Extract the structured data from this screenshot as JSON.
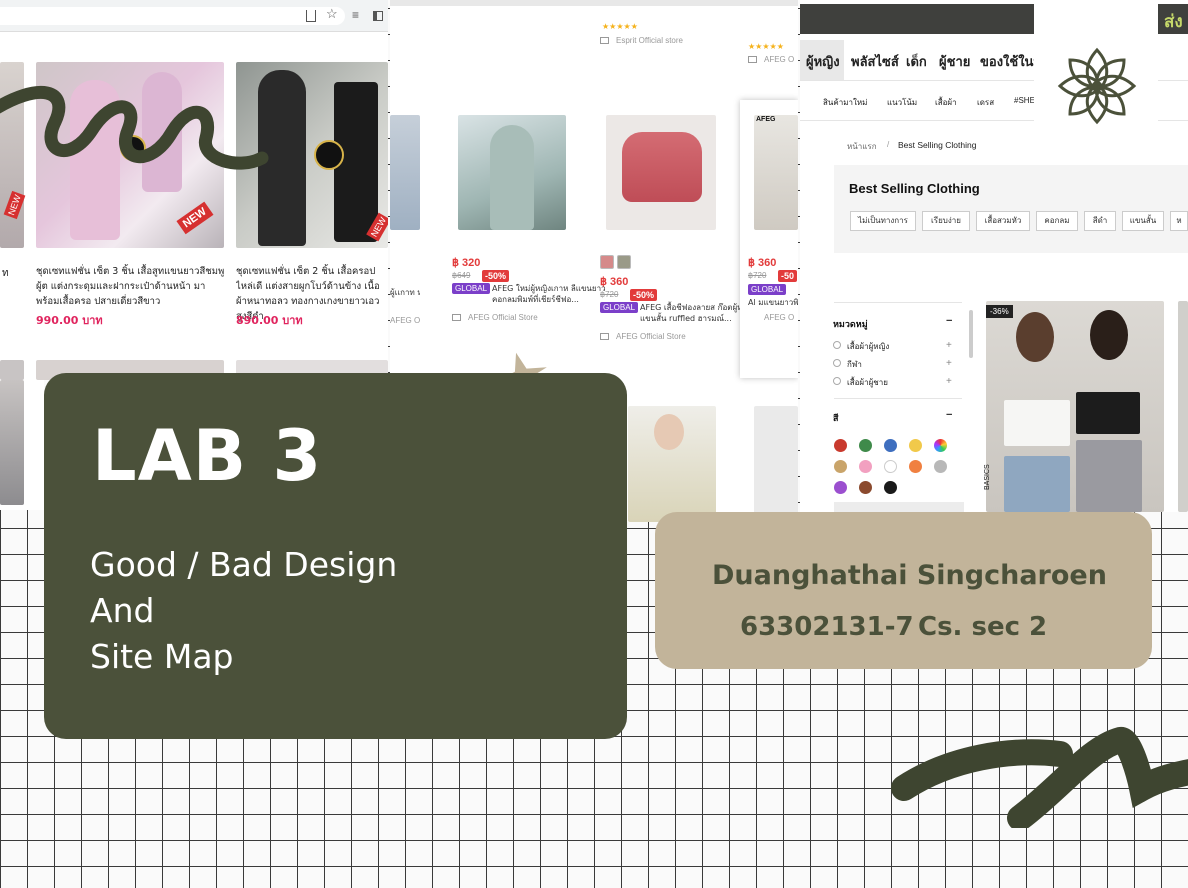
{
  "shot1": {
    "p1_title": "ชุดเซทแฟชั่น เซ็ต 3 ชิ้น เสื้อสูทแขนยาวสีชมพูผู้ต แต่งกระดุมและฝากระเป๋าด้านหน้า มาพร้อมเสื้อครอ ปสายเดี่ยวสีขาว",
    "p1_price": "990.00 บาท",
    "p2_title": "ชุดเซทแฟชั่น เซ็ต 2 ชิ้น เสื้อครอปไหล่เดี แต่งสายผูกโบว์ด้านข้าง เนื้อผ้าหนาทอลว ทองกางเกงขายาวเอวสูงสีดำ",
    "p2_price": "890.00 บาท",
    "left_partial": "ท",
    "new_badge": "NEW"
  },
  "shot2": {
    "store_top": "Esprit Official store",
    "store_top_right": "AFEG O",
    "stars": "★★★★★",
    "a_price": "฿ 320",
    "a_old": "฿649",
    "a_disc": "-50%",
    "a_title": "AFEG ใหม่ผู้หญิงเกาห ลีแขนยาวคอกลมพิมพ์ที่เชียร์ชีฟอ...",
    "a_store": "AFEG Official Store",
    "b_price": "฿ 360",
    "b_old": "฿720",
    "b_disc": "-50%",
    "global": "GLOBAL",
    "b_title": "AFEG เสื้อชีฟองลายส ก๊อตผู้หญิงแขนสั้น ruffled ฮารมณ์...",
    "b_store": "AFEG Official Store",
    "c_label": "AFEG",
    "c_price": "฿ 360",
    "c_old": "฿720",
    "c_disc": "-50",
    "c_title": "Al มแขนยาวพิมพ์",
    "c_store": "AFEG O",
    "left_title": "ผู้เเกาท หมาย ...",
    "left_store": "AFEG O"
  },
  "shot3": {
    "top_right": "ส่ง",
    "nav1": [
      "ผู้หญิง",
      "พลัสไซส์",
      "เด็ก",
      "ผู้ชาย",
      "ของใช้ในบ้"
    ],
    "nav2": [
      "สินค้ามาใหม่",
      "แนวโน้ม",
      "เสื้อผ้า",
      "เดรส",
      "#SHE"
    ],
    "breadcrumb_home": "หน้าแรก",
    "breadcrumb_sep": "/",
    "breadcrumb_current": "Best Selling Clothing",
    "title": "Best Selling Clothing",
    "chips": [
      "ไม่เป็นทางการ",
      "เรียบง่าย",
      "เสื้อสวมหัว",
      "คอกลม",
      "สีดำ",
      "แขนสั้น",
      "ห"
    ],
    "category_heading": "หมวดหมู่",
    "categories": [
      "เสื้อผ้าผู้หญิง",
      "กีฬา",
      "เสื้อผ้าผู้ชาย"
    ],
    "color_heading": "สี",
    "discount": "-36%",
    "side_text": "BASICS",
    "colors": [
      "#c93a2e",
      "#3f8a4a",
      "#3f6fbf",
      "#f1c94a",
      "rainbow",
      "#c9a46a",
      "#f2a0c0",
      "#ffffff",
      "#f08040",
      "#b8b8b8",
      "#9b4fcf",
      "#8b4a2e",
      "#1a1a1a"
    ]
  },
  "title_card": {
    "heading": "LAB 3",
    "line1": "Good / Bad Design",
    "line2": "And",
    "line3": "Site Map"
  },
  "name_card": {
    "name": "Duanghathai Singcharoen",
    "id": "63302131-7",
    "section": "Cs. sec 2"
  },
  "theme": {
    "dark_green": "#4b513a",
    "beige": "#c2b49a",
    "price_pink": "#e0245e"
  }
}
